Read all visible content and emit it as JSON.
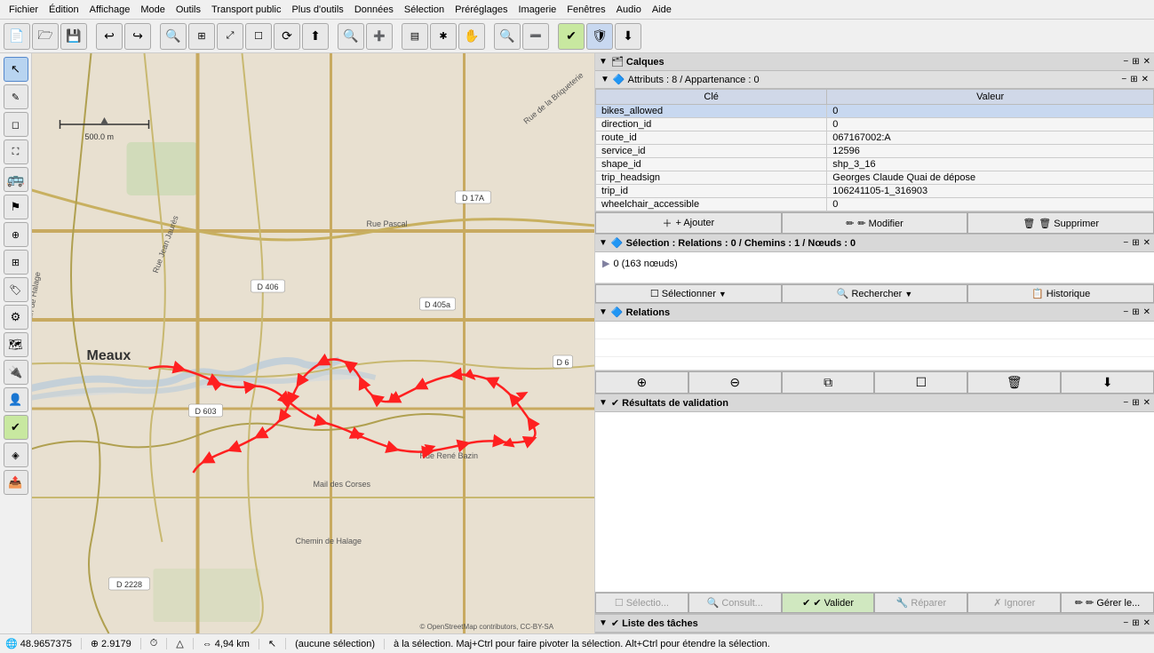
{
  "menubar": {
    "items": [
      "Fichier",
      "Édition",
      "Affichage",
      "Mode",
      "Outils",
      "Transport public",
      "Plus d'outils",
      "Données",
      "Sélection",
      "Préréglages",
      "Imagerie",
      "Fenêtres",
      "Audio",
      "Aide"
    ]
  },
  "toolbar": {
    "buttons": [
      {
        "name": "new-btn",
        "icon": "📄"
      },
      {
        "name": "open-btn",
        "icon": "🗁"
      },
      {
        "name": "save-btn",
        "icon": "💾"
      },
      {
        "name": "undo-btn",
        "icon": "↩"
      },
      {
        "name": "redo-btn",
        "icon": "↪"
      },
      {
        "name": "zoom-in-btn",
        "icon": "🔍"
      },
      {
        "name": "zoom-fit-btn",
        "icon": "⊞"
      },
      {
        "name": "move-btn",
        "icon": "⤢"
      },
      {
        "name": "select-btn",
        "icon": "🔲"
      },
      {
        "name": "refresh-btn",
        "icon": "⟳"
      },
      {
        "name": "upload-btn",
        "icon": "⬆"
      },
      {
        "name": "search-btn",
        "icon": "🔍"
      },
      {
        "name": "zoom-in2-btn",
        "icon": "➕"
      },
      {
        "name": "layers-btn",
        "icon": "▤"
      },
      {
        "name": "node-btn",
        "icon": "✱"
      },
      {
        "name": "grab-btn",
        "icon": "✋"
      },
      {
        "name": "search2-btn",
        "icon": "🔍"
      },
      {
        "name": "zoom-out-btn",
        "icon": "➖"
      },
      {
        "name": "validate-btn",
        "icon": "✔"
      },
      {
        "name": "shield-btn",
        "icon": "🛡"
      },
      {
        "name": "download-btn",
        "icon": "⬇"
      }
    ]
  },
  "left_tools": {
    "tools": [
      {
        "name": "cursor-tool",
        "icon": "↖",
        "active": true
      },
      {
        "name": "draw-way-tool",
        "icon": "✏"
      },
      {
        "name": "draw-area-tool",
        "icon": "◻"
      },
      {
        "name": "improve-tool",
        "icon": "🔧"
      },
      {
        "name": "bus-tool",
        "icon": "🚌"
      },
      {
        "name": "measure-tool",
        "icon": "📐"
      },
      {
        "name": "zoom-tool",
        "icon": "🔍"
      },
      {
        "name": "layers-tool",
        "icon": "⊞"
      },
      {
        "name": "tags-tool",
        "icon": "🏷"
      },
      {
        "name": "gear-tool",
        "icon": "⚙"
      },
      {
        "name": "map-tool",
        "icon": "🗺"
      },
      {
        "name": "plug-tool",
        "icon": "🔌"
      },
      {
        "name": "user-tool",
        "icon": "👤"
      },
      {
        "name": "check-tool",
        "icon": "✔"
      },
      {
        "name": "diamond-tool",
        "icon": "◈"
      },
      {
        "name": "upload2-tool",
        "icon": "📤"
      }
    ]
  },
  "map": {
    "city": "Meaux",
    "credit": "© OpenStreetMap contributors, CC-BY-SA",
    "scale": "500.0 m",
    "roads": [
      "D 17A",
      "D 406",
      "D 603",
      "D 405a",
      "D 6",
      "D 2228"
    ],
    "streets": [
      "Rue Jean Jaurès",
      "Rue Pascal",
      "Rue René Bazin",
      "Mail des Corses",
      "Chemin de Halage",
      "Rue de la Briqueterie"
    ]
  },
  "panels": {
    "layers": {
      "title": "Calques",
      "attributes_header": "Attributs : 8 / Appartenance : 0",
      "table_headers": [
        "Clé",
        "Valeur"
      ],
      "rows": [
        {
          "key": "bikes_allowed",
          "value": "0",
          "selected": true
        },
        {
          "key": "direction_id",
          "value": "0"
        },
        {
          "key": "route_id",
          "value": "067167002:A"
        },
        {
          "key": "service_id",
          "value": "12596"
        },
        {
          "key": "shape_id",
          "value": "shp_3_16"
        },
        {
          "key": "trip_headsign",
          "value": "Georges Claude Quai de dépose"
        },
        {
          "key": "trip_id",
          "value": "106241105-1_316903"
        },
        {
          "key": "wheelchair_accessible",
          "value": "0"
        }
      ],
      "buttons": {
        "add": "+ Ajouter",
        "modify": "✏ Modifier",
        "delete": "🗑 Supprimer"
      }
    },
    "selection": {
      "title": "Sélection : Relations : 0 / Chemins : 1 / Nœuds : 0",
      "tree_item": "0 (163 nœuds)",
      "buttons": {
        "select": "Sélectionner",
        "search": "Rechercher",
        "history": "Historique"
      }
    },
    "relations": {
      "title": "Relations"
    },
    "validation": {
      "title": "Résultats de validation",
      "buttons": {
        "select": "Sélectio...",
        "consult": "Consult...",
        "validate": "✔ Valider",
        "repair": "Réparer",
        "ignore": "Ignorer",
        "manage": "✏ Gérer le..."
      }
    },
    "tasks": {
      "title": "Liste des tâches"
    }
  },
  "statusbar": {
    "lat": "48.9657375",
    "lon": "2.9179",
    "scale": "4,94 km",
    "selection": "(aucune sélection)",
    "hint": "à la sélection. Maj+Ctrl pour faire pivoter la sélection. Alt+Ctrl pour étendre la sélection."
  }
}
